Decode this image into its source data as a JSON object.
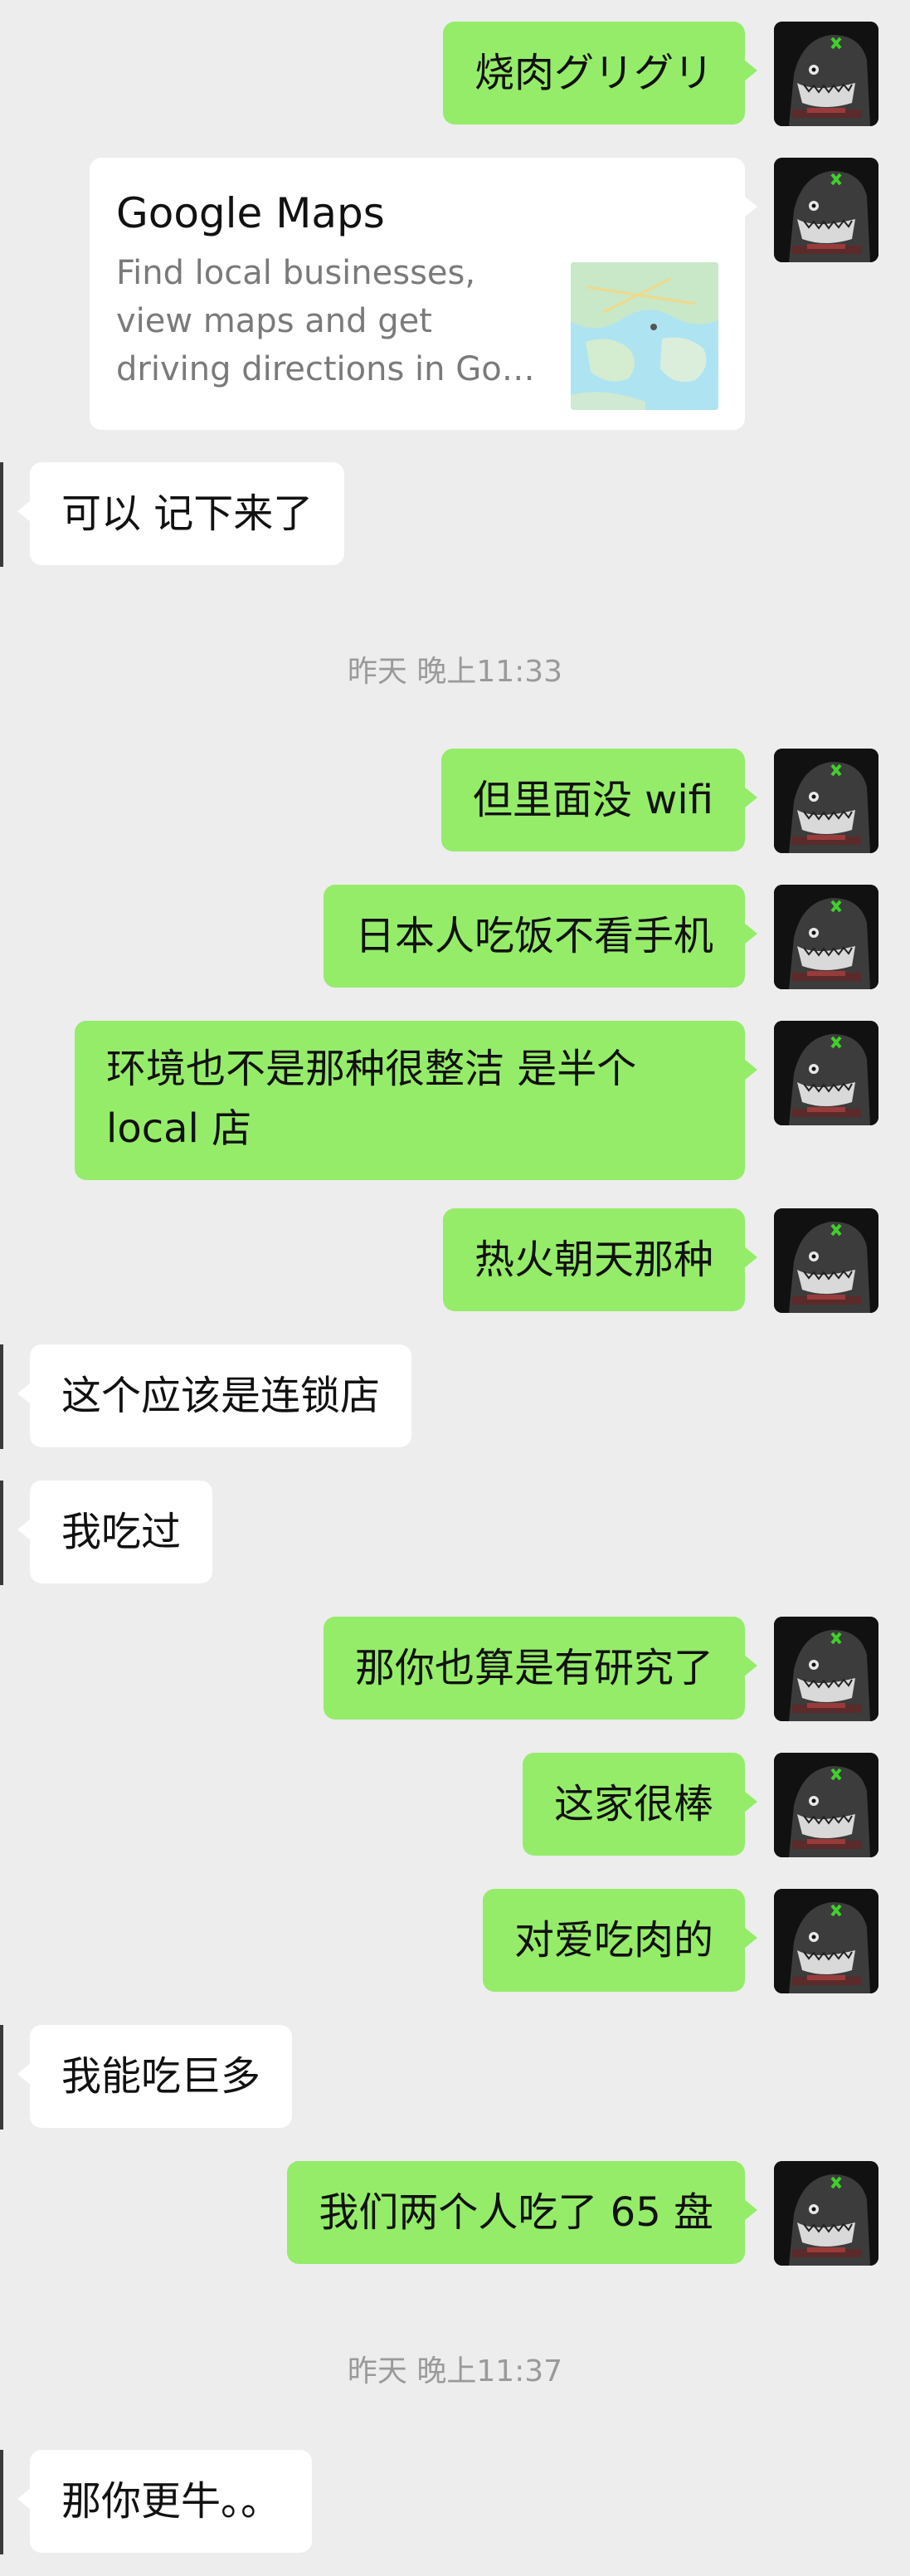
{
  "messages": [
    {
      "id": "m1",
      "side": "out",
      "text": "烧肉グリグリ"
    },
    {
      "id": "m2",
      "side": "out",
      "type": "link-card",
      "title": "Google Maps",
      "desc_lines": [
        "Find local businesses,",
        "view maps and get",
        "driving directions in Go…"
      ]
    },
    {
      "id": "m3",
      "side": "in",
      "text": "可以 记下来了"
    },
    {
      "id": "t1",
      "type": "timestamp",
      "text": "昨天 晚上11:33"
    },
    {
      "id": "m4",
      "side": "out",
      "text": "但里面没 wifi"
    },
    {
      "id": "m5",
      "side": "out",
      "text": "日本人吃饭不看手机"
    },
    {
      "id": "m6",
      "side": "out",
      "text_line1": "环境也不是那种很整洁 是半个",
      "text_line2": "local 店"
    },
    {
      "id": "m7",
      "side": "out",
      "text": "热火朝天那种"
    },
    {
      "id": "m8",
      "side": "in",
      "text": "这个应该是连锁店"
    },
    {
      "id": "m9",
      "side": "in",
      "text": "我吃过"
    },
    {
      "id": "m10",
      "side": "out",
      "text": "那你也算是有研究了"
    },
    {
      "id": "m11",
      "side": "out",
      "text": "这家很棒"
    },
    {
      "id": "m12",
      "side": "out",
      "text": "对爱吃肉的"
    },
    {
      "id": "m13",
      "side": "in",
      "text": "我能吃巨多"
    },
    {
      "id": "m14",
      "side": "out",
      "text": "我们两个人吃了 65 盘"
    },
    {
      "id": "t2",
      "type": "timestamp",
      "text": "昨天 晚上11:37"
    },
    {
      "id": "m15",
      "side": "in",
      "text": "那你更牛。。"
    }
  ],
  "colors": {
    "background": "#ededed",
    "outgoing_bubble": "#95ec69",
    "incoming_bubble": "#ffffff",
    "timestamp_text": "#9a9a9a"
  },
  "icons": {
    "avatar": "shark-avatar-icon",
    "map_thumbnail": "map-thumbnail-icon"
  }
}
